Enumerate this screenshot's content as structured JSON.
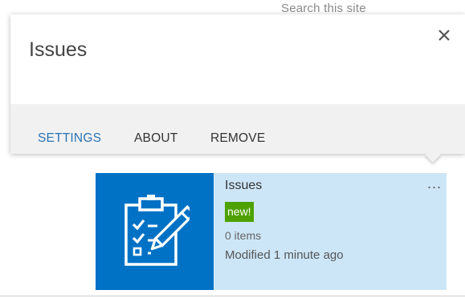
{
  "search": {
    "placeholder_text": "Search this site"
  },
  "callout": {
    "title": "Issues",
    "close_icon": "close-icon",
    "actions": [
      {
        "label": "SETTINGS"
      },
      {
        "label": "ABOUT"
      },
      {
        "label": "REMOVE"
      }
    ]
  },
  "tile": {
    "name": "Issues",
    "badge": "new!",
    "item_count": "0 items",
    "modified": "Modified 1 minute ago",
    "menu_label": "...",
    "icon": "clipboard-checklist-icon"
  },
  "colors": {
    "accent_link": "#2a73b6",
    "tile_icon_bg": "#0072c6",
    "tile_bg": "#cde6f7",
    "badge_bg": "#4ea100",
    "footer_bg": "#f1f1f1"
  }
}
